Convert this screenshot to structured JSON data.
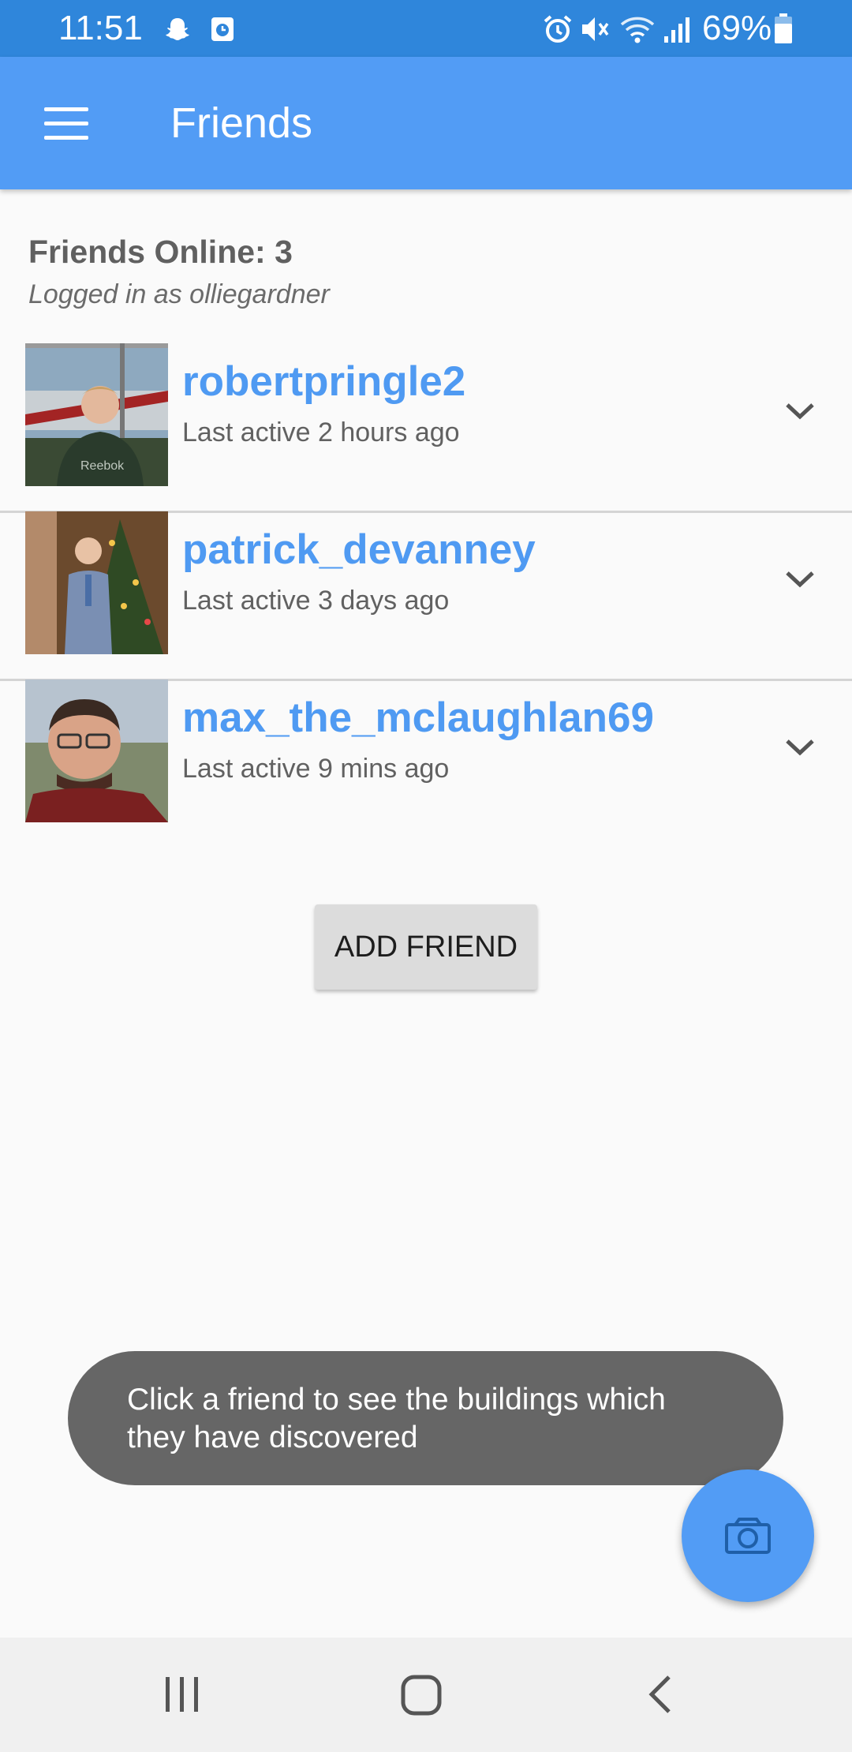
{
  "status_bar": {
    "time": "11:51",
    "battery": "69%",
    "icons": [
      "snapchat-icon",
      "clock-app-icon",
      "alarm-icon",
      "mute-icon",
      "wifi-icon",
      "signal-icon",
      "battery-icon"
    ]
  },
  "app_bar": {
    "title": "Friends",
    "menu_icon": "hamburger-menu-icon"
  },
  "header": {
    "online_count": "Friends Online: 3",
    "logged_in": "Logged in as olliegardner"
  },
  "friends": [
    {
      "username": "robertpringle2",
      "last_active": "Last active 2 hours ago"
    },
    {
      "username": "patrick_devanney",
      "last_active": "Last active 3 days ago"
    },
    {
      "username": "max_the_mclaughlan69",
      "last_active": "Last active 9 mins ago"
    }
  ],
  "add_friend_label": "ADD FRIEND",
  "toast": {
    "line1": "Click a friend to see the buildings which",
    "line2": "they have discovered"
  },
  "fab_icon": "camera-icon",
  "nav_bar": {
    "icons": [
      "recent-apps-icon",
      "home-icon",
      "back-icon"
    ]
  },
  "colors": {
    "status_bar": "#2f86db",
    "app_bar": "#529cf5",
    "username": "#4f9af2",
    "toast_bg": "#666666"
  }
}
